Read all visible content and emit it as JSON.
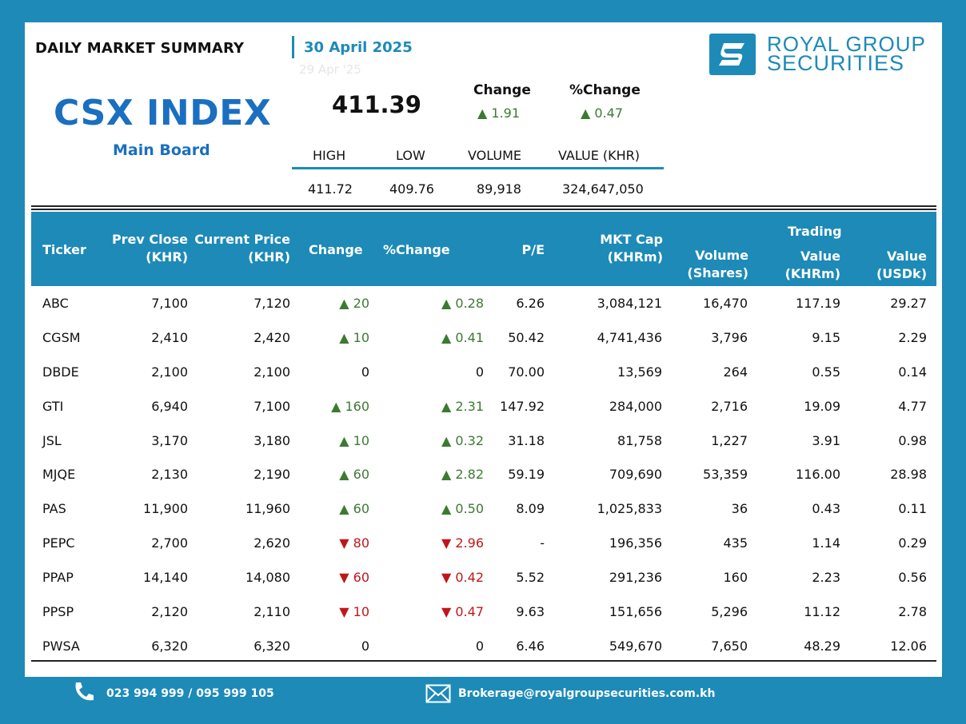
{
  "header": {
    "title": "DAILY MARKET SUMMARY",
    "date": "30 April 2025",
    "faded_date": "29 Apr '25"
  },
  "logo": {
    "line1": "ROYAL GROUP",
    "line2": "SECURITIES",
    "icon": "rgs-logo-mark"
  },
  "index": {
    "name": "CSX INDEX",
    "board": "Main Board",
    "value": "411.39",
    "change_label": "Change",
    "change_value": "▲ 1.91",
    "pct_change_label": "%Change",
    "pct_change_value": "▲ 0.47"
  },
  "stats": {
    "headers": [
      "HIGH",
      "LOW",
      "VOLUME",
      "VALUE (KHR)"
    ],
    "values": [
      "411.72",
      "409.76",
      "89,918",
      "324,647,050"
    ]
  },
  "table": {
    "headers": {
      "ticker": "Ticker",
      "prev_close_1": "Prev Close",
      "prev_close_2": "(KHR)",
      "current_price_1": "Current Price",
      "current_price_2": "(KHR)",
      "change": "Change",
      "pct_change": "%Change",
      "pe": "P/E",
      "mkt_cap_1": "MKT Cap",
      "mkt_cap_2": "(KHRm)",
      "volume_1": "Volume",
      "volume_2": "(Shares)",
      "trading": "Trading",
      "value_khr_1": "Value",
      "value_khr_2": "(KHRm)",
      "value_usd_1": "Value",
      "value_usd_2": "(USDk)"
    },
    "rows": [
      {
        "ticker": "ABC",
        "prev": "7,100",
        "cur": "7,120",
        "chg": "▲ 20",
        "pct": "▲ 0.28",
        "dir": "up",
        "pe": "6.26",
        "cap": "3,084,121",
        "vol": "16,470",
        "vkhr": "117.19",
        "vusd": "29.27"
      },
      {
        "ticker": "CGSM",
        "prev": "2,410",
        "cur": "2,420",
        "chg": "▲ 10",
        "pct": "▲ 0.41",
        "dir": "up",
        "pe": "50.42",
        "cap": "4,741,436",
        "vol": "3,796",
        "vkhr": "9.15",
        "vusd": "2.29"
      },
      {
        "ticker": "DBDE",
        "prev": "2,100",
        "cur": "2,100",
        "chg": "0",
        "pct": "0",
        "dir": "flat",
        "pe": "70.00",
        "cap": "13,569",
        "vol": "264",
        "vkhr": "0.55",
        "vusd": "0.14"
      },
      {
        "ticker": "GTI",
        "prev": "6,940",
        "cur": "7,100",
        "chg": "▲ 160",
        "pct": "▲ 2.31",
        "dir": "up",
        "pe": "147.92",
        "cap": "284,000",
        "vol": "2,716",
        "vkhr": "19.09",
        "vusd": "4.77"
      },
      {
        "ticker": "JSL",
        "prev": "3,170",
        "cur": "3,180",
        "chg": "▲ 10",
        "pct": "▲ 0.32",
        "dir": "up",
        "pe": "31.18",
        "cap": "81,758",
        "vol": "1,227",
        "vkhr": "3.91",
        "vusd": "0.98"
      },
      {
        "ticker": "MJQE",
        "prev": "2,130",
        "cur": "2,190",
        "chg": "▲ 60",
        "pct": "▲ 2.82",
        "dir": "up",
        "pe": "59.19",
        "cap": "709,690",
        "vol": "53,359",
        "vkhr": "116.00",
        "vusd": "28.98"
      },
      {
        "ticker": "PAS",
        "prev": "11,900",
        "cur": "11,960",
        "chg": "▲ 60",
        "pct": "▲ 0.50",
        "dir": "up",
        "pe": "8.09",
        "cap": "1,025,833",
        "vol": "36",
        "vkhr": "0.43",
        "vusd": "0.11"
      },
      {
        "ticker": "PEPC",
        "prev": "2,700",
        "cur": "2,620",
        "chg": "▼ 80",
        "pct": "▼ 2.96",
        "dir": "down",
        "pe": "-",
        "cap": "196,356",
        "vol": "435",
        "vkhr": "1.14",
        "vusd": "0.29"
      },
      {
        "ticker": "PPAP",
        "prev": "14,140",
        "cur": "14,080",
        "chg": "▼ 60",
        "pct": "▼ 0.42",
        "dir": "down",
        "pe": "5.52",
        "cap": "291,236",
        "vol": "160",
        "vkhr": "2.23",
        "vusd": "0.56"
      },
      {
        "ticker": "PPSP",
        "prev": "2,120",
        "cur": "2,110",
        "chg": "▼ 10",
        "pct": "▼ 0.47",
        "dir": "down",
        "pe": "9.63",
        "cap": "151,656",
        "vol": "5,296",
        "vkhr": "11.12",
        "vusd": "2.78"
      },
      {
        "ticker": "PWSA",
        "prev": "6,320",
        "cur": "6,320",
        "chg": "0",
        "pct": "0",
        "dir": "flat",
        "pe": "6.46",
        "cap": "549,670",
        "vol": "7,650",
        "vkhr": "48.29",
        "vusd": "12.06"
      }
    ]
  },
  "footer": {
    "phone": "023 994 999 / 095 999 105",
    "phone_icon": "phone-icon",
    "email": "Brokerage@royalgroupsecurities.com.kh",
    "email_icon": "mail-icon"
  },
  "colors": {
    "brand": "#1d8ab8",
    "index_blue": "#1a6fc0",
    "up": "#3c7a32",
    "down": "#c0161a"
  }
}
